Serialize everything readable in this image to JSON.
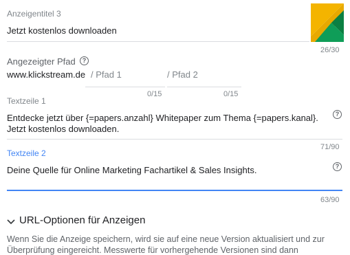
{
  "headline3": {
    "label": "Anzeigentitel 3",
    "value": "Jetzt kostenlos downloaden",
    "counter": "26/30"
  },
  "path": {
    "label": "Angezeigter Pfad",
    "domain": "www.klickstream.de",
    "path1_placeholder": "/ Pfad 1",
    "path2_placeholder": "/ Pfad 2",
    "path1_counter": "0/15",
    "path2_counter": "0/15"
  },
  "description1": {
    "label": "Textzeile 1",
    "line1": "Entdecke jetzt über {=papers.anzahl} Whitepaper zum Thema {=papers.kanal}.",
    "line2": "Jetzt kostenlos downloaden.",
    "counter": "71/90"
  },
  "description2": {
    "label": "Textzeile 2",
    "value": "Deine Quelle für Online Marketing Fachartikel & Sales Insights.",
    "counter": "63/90"
  },
  "url_options": {
    "title": "URL-Optionen für Anzeigen"
  },
  "notice": {
    "line1": "Wenn Sie die Anzeige speichern, wird sie auf eine neue Version aktualisiert und zur",
    "line2": "Überprüfung eingereicht. Messwerte für vorhergehende Versionen sind dann"
  },
  "help_glyph": "?",
  "colors": {
    "accent_blue": "#4285f4",
    "logo_yellow": "#f4b400",
    "logo_green": "#0f9d58"
  }
}
